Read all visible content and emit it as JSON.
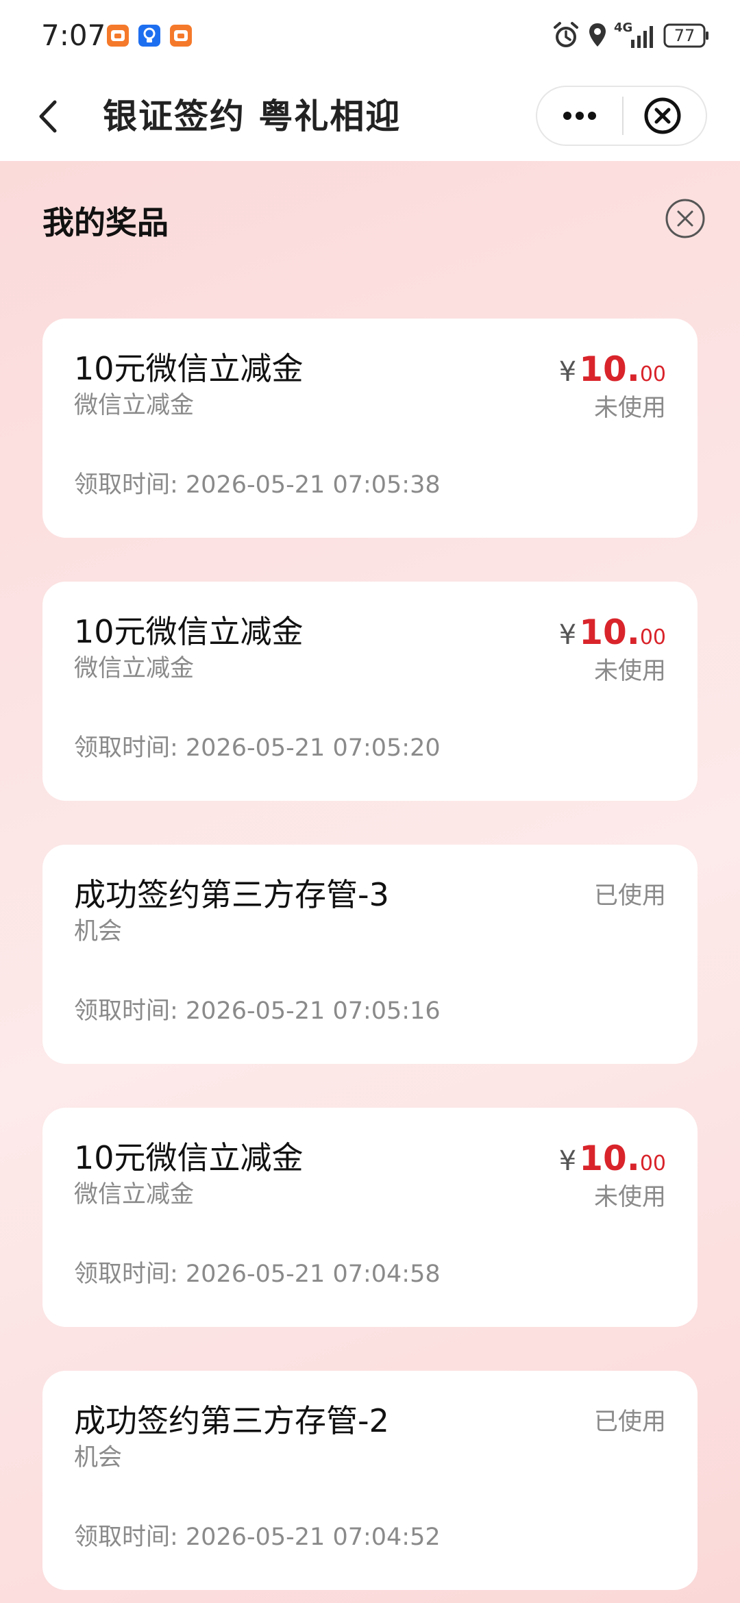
{
  "status_bar": {
    "time": "7:07",
    "network": "4G",
    "battery": "77"
  },
  "nav": {
    "title": "银证签约 粤礼相迎"
  },
  "panel": {
    "title": "我的奖品"
  },
  "prizes": [
    {
      "title": "10元微信立减金",
      "subtitle": "微信立减金",
      "time": "领取时间: 2026-05-21 07:05:38",
      "currency": "¥",
      "price_int": "10.",
      "price_dec": "00",
      "status": "未使用"
    },
    {
      "title": "10元微信立减金",
      "subtitle": "微信立减金",
      "time": "领取时间: 2026-05-21 07:05:20",
      "currency": "¥",
      "price_int": "10.",
      "price_dec": "00",
      "status": "未使用"
    },
    {
      "title": "成功签约第三方存管-3",
      "subtitle": "机会",
      "time": "领取时间: 2026-05-21 07:05:16",
      "status": "已使用"
    },
    {
      "title": "10元微信立减金",
      "subtitle": "微信立减金",
      "time": "领取时间: 2026-05-21 07:04:58",
      "currency": "¥",
      "price_int": "10.",
      "price_dec": "00",
      "status": "未使用"
    },
    {
      "title": "成功签约第三方存管-2",
      "subtitle": "机会",
      "time": "领取时间: 2026-05-21 07:04:52",
      "status": "已使用"
    }
  ],
  "colors": {
    "price_red": "#d9242b",
    "background_pink": "#fbd9d9",
    "card_white": "#ffffff"
  },
  "icons": {
    "back": "back-arrow-icon",
    "more": "more-dots-icon",
    "close_capsule": "close-circle-icon",
    "close_panel": "close-circle-icon",
    "alarm": "alarm-icon",
    "location": "location-icon",
    "signal": "signal-bars-icon",
    "battery": "battery-icon"
  }
}
